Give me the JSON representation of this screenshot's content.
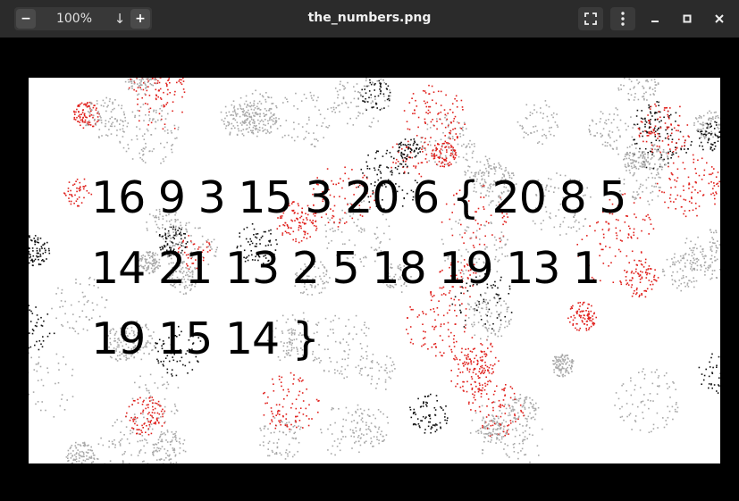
{
  "toolbar": {
    "zoom_out_icon": "minus-icon",
    "zoom_level": "100%",
    "download_icon": "down-arrow-icon",
    "zoom_in_icon": "plus-icon"
  },
  "window": {
    "title": "the_numbers.png",
    "fullscreen_icon": "fullscreen-icon",
    "menu_icon": "vertical-dots-icon",
    "minimize_icon": "minimize-icon",
    "maximize_icon": "maximize-icon",
    "close_icon": "close-icon"
  },
  "image": {
    "lines": [
      "16 9 3 15 3 20 6 { 20 8 5",
      "14 21 13 2 5 18 19 13 1",
      "19 15 14 }"
    ],
    "colors": {
      "background": "#ffffff",
      "text": "#000000",
      "noise_red": "#e0201c",
      "noise_gray": "#a8a8a8",
      "noise_black": "#111111"
    }
  }
}
